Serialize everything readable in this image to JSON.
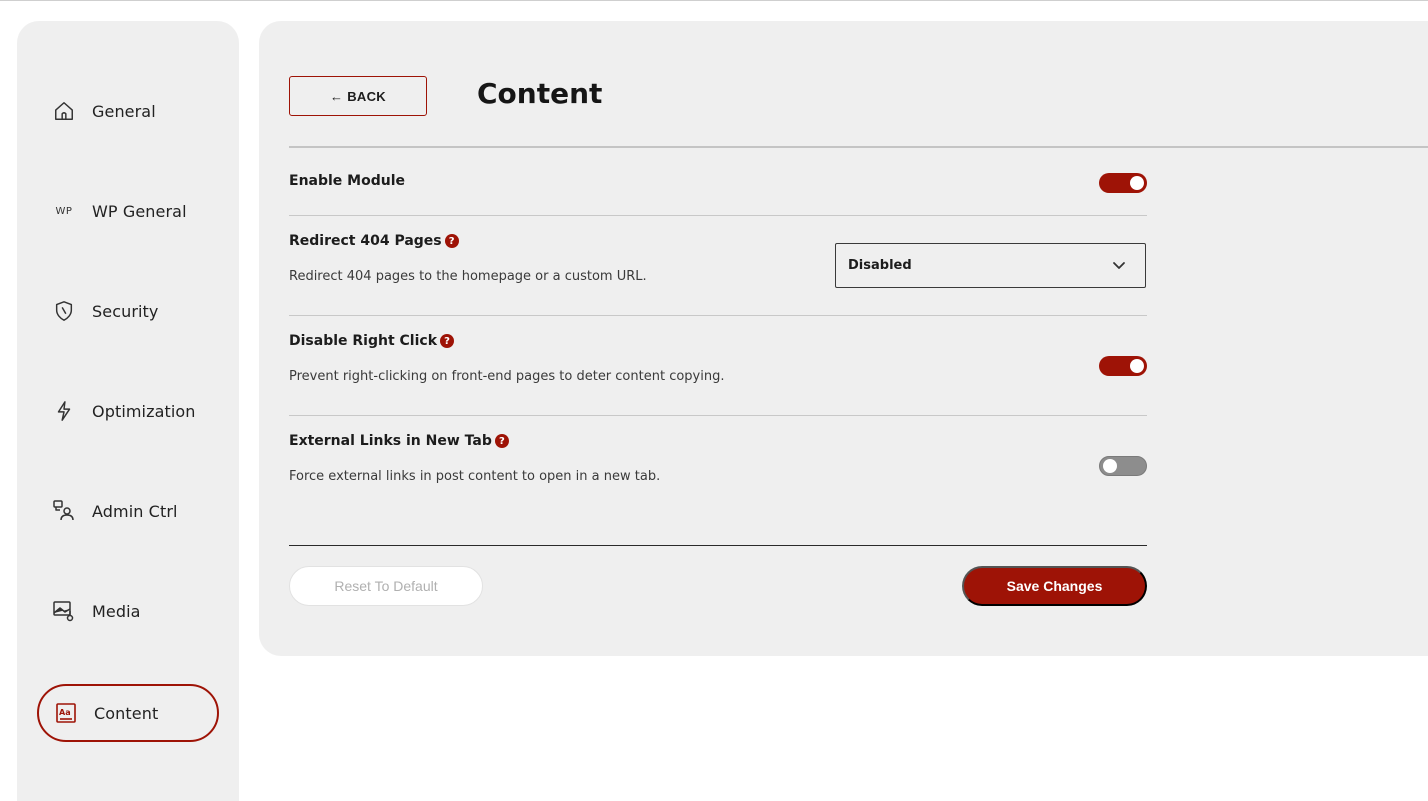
{
  "colors": {
    "accent": "#9e1306",
    "panel_bg": "#efefef",
    "toggle_off": "#8d8d8d"
  },
  "sidebar": {
    "items": [
      {
        "label": "General",
        "icon": "home-icon",
        "active": false
      },
      {
        "label": "WP General",
        "icon": "wp-icon",
        "icon_text": "WP",
        "active": false
      },
      {
        "label": "Security",
        "icon": "shield-icon",
        "active": false
      },
      {
        "label": "Optimization",
        "icon": "lightning-icon",
        "active": false
      },
      {
        "label": "Admin Ctrl",
        "icon": "admin-user-icon",
        "active": false
      },
      {
        "label": "Media",
        "icon": "image-icon",
        "active": false
      },
      {
        "label": "Content",
        "icon": "text-content-icon",
        "active": true
      }
    ]
  },
  "header": {
    "back_label": "← BACK",
    "title": "Content"
  },
  "settings": {
    "enable_module": {
      "title": "Enable Module",
      "enabled": true
    },
    "redirect_404": {
      "title": "Redirect 404 Pages",
      "help": "?",
      "description": "Redirect 404 pages to the homepage or a custom URL.",
      "selected": "Disabled"
    },
    "disable_right_click": {
      "title": "Disable Right Click",
      "help": "?",
      "description": "Prevent right-clicking on front-end pages to deter content copying.",
      "enabled": true
    },
    "external_links": {
      "title": "External Links in New Tab",
      "help": "?",
      "description": "Force external links in post content to open in a new tab.",
      "enabled": false
    }
  },
  "footer": {
    "reset_label": "Reset To Default",
    "save_label": "Save Changes"
  }
}
